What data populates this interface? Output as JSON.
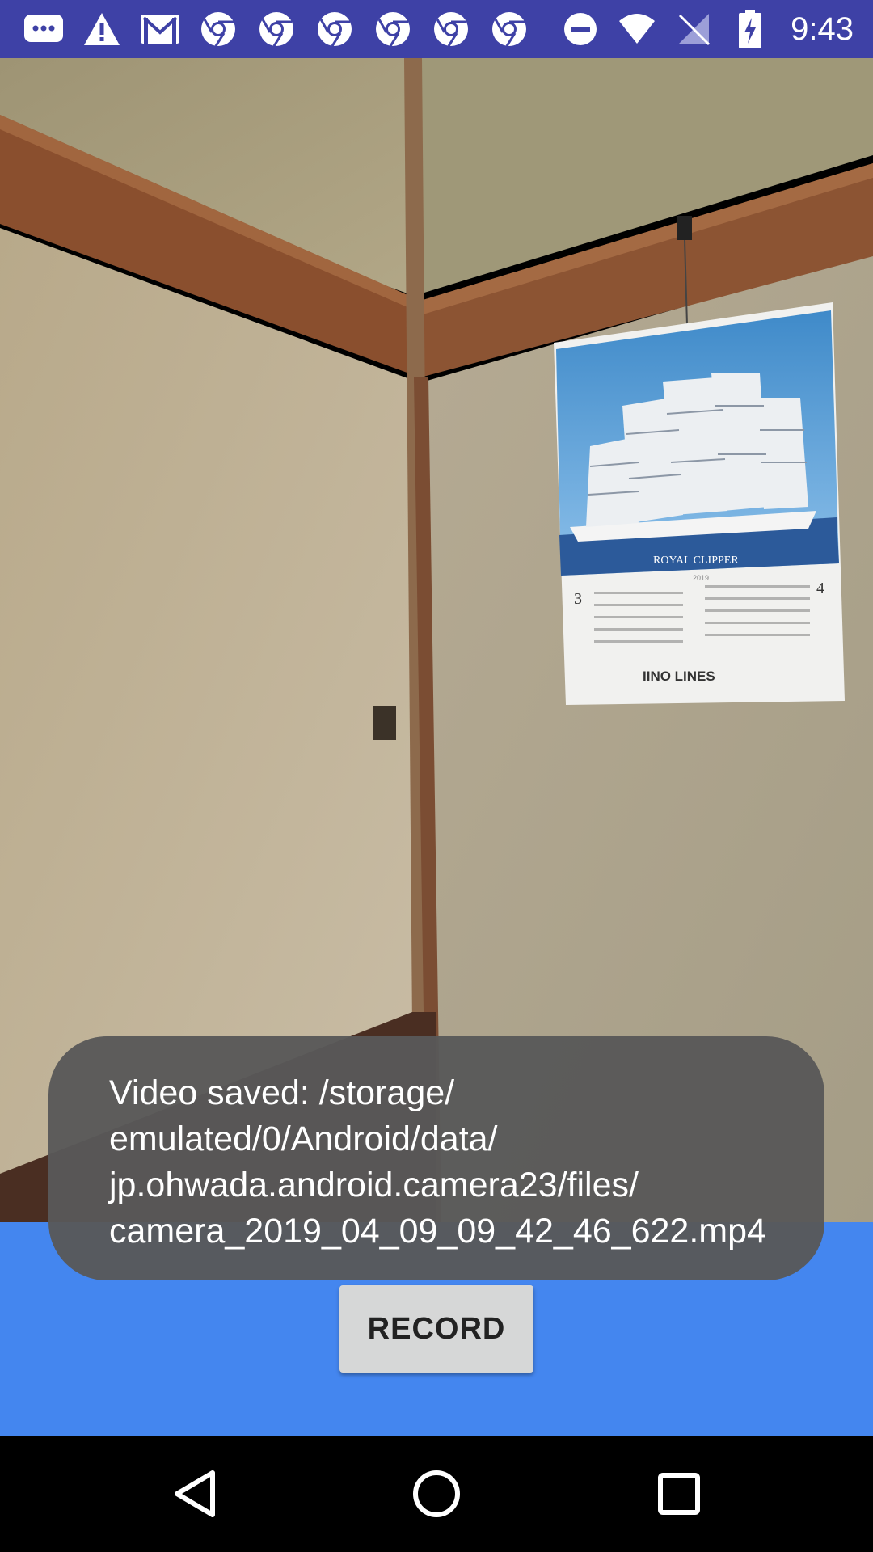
{
  "status_bar": {
    "time": "9:43",
    "left_icons": [
      "messaging-icon",
      "alert-icon",
      "gmail-icon",
      "chrome-icon",
      "chrome-icon",
      "chrome-icon",
      "chrome-icon",
      "chrome-icon",
      "chrome-icon"
    ],
    "right_icons": [
      "do-not-disturb-icon",
      "wifi-icon",
      "no-sim-icon",
      "battery-charging-icon"
    ],
    "background_color": "#3e41a6"
  },
  "camera_preview": {
    "calendar": {
      "brand": "IINO LINES",
      "ship_name": "ROYAL CLIPPER",
      "year": "2019",
      "month_left": "3",
      "month_right": "4"
    }
  },
  "toast": {
    "lines": [
      "Video saved: /storage/",
      "emulated/0/Android/data/",
      "jp.ohwada.android.camera23/files/",
      "camera_2019_04_09_09_42_46_622.mp4"
    ]
  },
  "controls": {
    "record_label": "RECORD",
    "background_color": "#4486ef"
  },
  "nav_bar": {
    "buttons": [
      "back-icon",
      "home-icon",
      "recents-icon"
    ]
  }
}
